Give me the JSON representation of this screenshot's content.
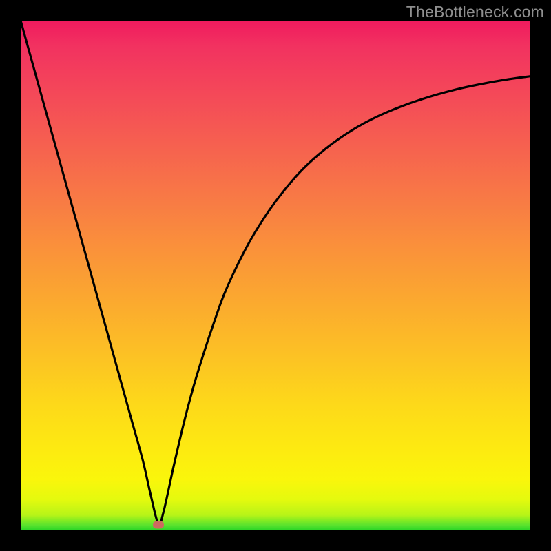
{
  "watermark": "TheBottleneck.com",
  "colors": {
    "frame": "#000000",
    "curve": "#000000",
    "marker": "#cd6b5f",
    "gradient_top": "#f01a5e",
    "gradient_bottom": "#27d627"
  },
  "chart_data": {
    "type": "line",
    "title": "",
    "xlabel": "",
    "ylabel": "",
    "xlim": [
      0,
      100
    ],
    "ylim": [
      0,
      100
    ],
    "grid": false,
    "legend": false,
    "marker": {
      "x": 27.0,
      "y": 1.1
    },
    "series": [
      {
        "name": "curve",
        "x": [
          0,
          2,
          4,
          6,
          8,
          10,
          12,
          14,
          16,
          18,
          20,
          22,
          24,
          25.5,
          27,
          28,
          30,
          32,
          34,
          36,
          38,
          40,
          43,
          46,
          50,
          55,
          60,
          65,
          70,
          75,
          80,
          85,
          90,
          95,
          100
        ],
        "values": [
          100,
          92.8,
          85.6,
          78.4,
          71.2,
          64.0,
          56.8,
          49.6,
          42.4,
          35.2,
          28.0,
          20.8,
          13.6,
          7.0,
          1.3,
          3.5,
          12.5,
          21.0,
          28.5,
          35.0,
          41.0,
          46.5,
          53.0,
          58.5,
          64.5,
          70.5,
          75.0,
          78.5,
          81.2,
          83.3,
          85.0,
          86.4,
          87.5,
          88.4,
          89.1
        ]
      }
    ]
  }
}
